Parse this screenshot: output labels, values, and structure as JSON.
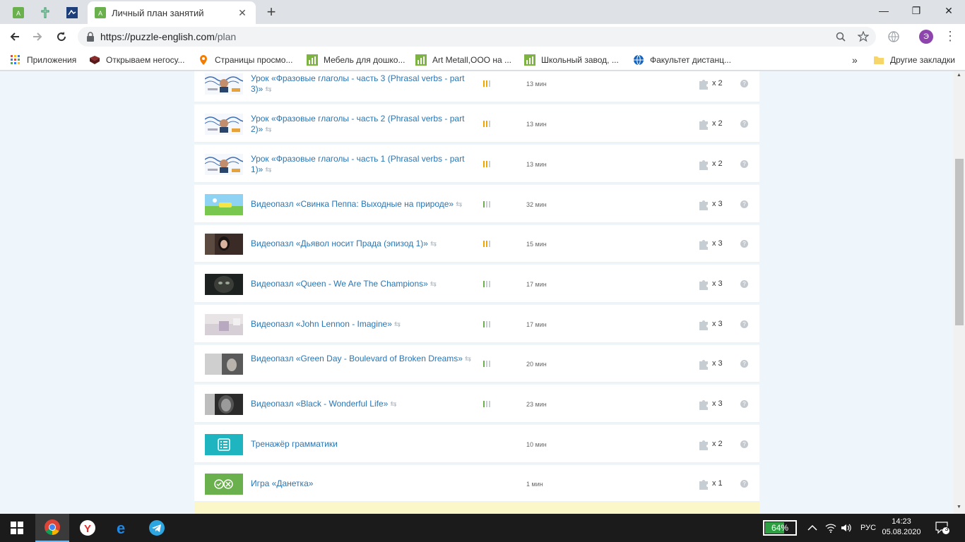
{
  "browser": {
    "tab_title": "Личный план занятий",
    "new_tab": "+",
    "url_host": "https://puzzle-english.com",
    "url_path": "/plan",
    "avatar_letter": "Э",
    "window": {
      "minimize": "—",
      "restore": "❐",
      "close": "✕"
    }
  },
  "bookmarks": {
    "items": [
      {
        "label": "Приложения"
      },
      {
        "label": "Открываем негосу..."
      },
      {
        "label": "Страницы просмо..."
      },
      {
        "label": "Мебель для дошко..."
      },
      {
        "label": "Art Metall,ООО на ..."
      },
      {
        "label": "Школьный завод, ..."
      },
      {
        "label": "Факультет дистанц..."
      }
    ],
    "overflow": "»",
    "other": "Другие закладки"
  },
  "plan": {
    "rows": [
      {
        "title": "Урок «Фразовые глаголы - часть 3 (Phrasal verbs - part 3)»",
        "thumb": "lesson",
        "level_colors": [
          "#f0a500",
          "#f0a500",
          "#c9ced3"
        ],
        "duration": "13 мин",
        "multiplier": "x 2"
      },
      {
        "title": "Урок «Фразовые глаголы - часть 2 (Phrasal verbs - part 2)»",
        "thumb": "lesson",
        "level_colors": [
          "#f0a500",
          "#f0a500",
          "#c9ced3"
        ],
        "duration": "13 мин",
        "multiplier": "x 2"
      },
      {
        "title": "Урок «Фразовые глаголы - часть 1 (Phrasal verbs - part 1)»",
        "thumb": "lesson",
        "level_colors": [
          "#f0a500",
          "#f0a500",
          "#c9ced3"
        ],
        "duration": "13 мин",
        "multiplier": "x 2"
      },
      {
        "title": "Видеопазл «Свинка Пеппа: Выходные на природе»",
        "thumb": "peppa",
        "level_colors": [
          "#6ab04c",
          "#c9ced3",
          "#c9ced3"
        ],
        "duration": "32 мин",
        "multiplier": "x 3"
      },
      {
        "title": "Видеопазл «Дьявол носит Прада (эпизод 1)»",
        "thumb": "prada",
        "level_colors": [
          "#f0a500",
          "#f0a500",
          "#c9ced3"
        ],
        "duration": "15 мин",
        "multiplier": "x 3"
      },
      {
        "title": "Видеопазл «Queen - We Are The Champions»",
        "thumb": "queen",
        "level_colors": [
          "#6ab04c",
          "#c9ced3",
          "#c9ced3"
        ],
        "duration": "17 мин",
        "multiplier": "x 3"
      },
      {
        "title": "Видеопазл «John Lennon - Imagine»",
        "thumb": "lennon",
        "level_colors": [
          "#6ab04c",
          "#c9ced3",
          "#c9ced3"
        ],
        "duration": "17 мин",
        "multiplier": "x 3"
      },
      {
        "title": "Видеопазл «Green Day - Boulevard of Broken Dreams»",
        "thumb": "greenday",
        "level_colors": [
          "#6ab04c",
          "#c9ced3",
          "#c9ced3"
        ],
        "duration": "20 мин",
        "multiplier": "x 3"
      },
      {
        "title": "Видеопазл «Black - Wonderful Life»",
        "thumb": "black",
        "level_colors": [
          "#6ab04c",
          "#c9ced3",
          "#c9ced3"
        ],
        "duration": "23 мин",
        "multiplier": "x 3"
      },
      {
        "title": "Тренажёр грамматики",
        "thumb": "grammar",
        "level_colors": [],
        "duration": "10 мин",
        "multiplier": "x 2"
      },
      {
        "title": "Игра «Данетка»",
        "thumb": "danetka",
        "level_colors": [],
        "duration": "1 мин",
        "multiplier": "x 1"
      }
    ],
    "help_glyph": "?",
    "repeat_glyph": "⇆"
  },
  "taskbar": {
    "battery": "64%",
    "battery_level": 0.64,
    "lang": "РУС",
    "time": "14:23",
    "date": "05.08.2020",
    "notifications": "3"
  }
}
